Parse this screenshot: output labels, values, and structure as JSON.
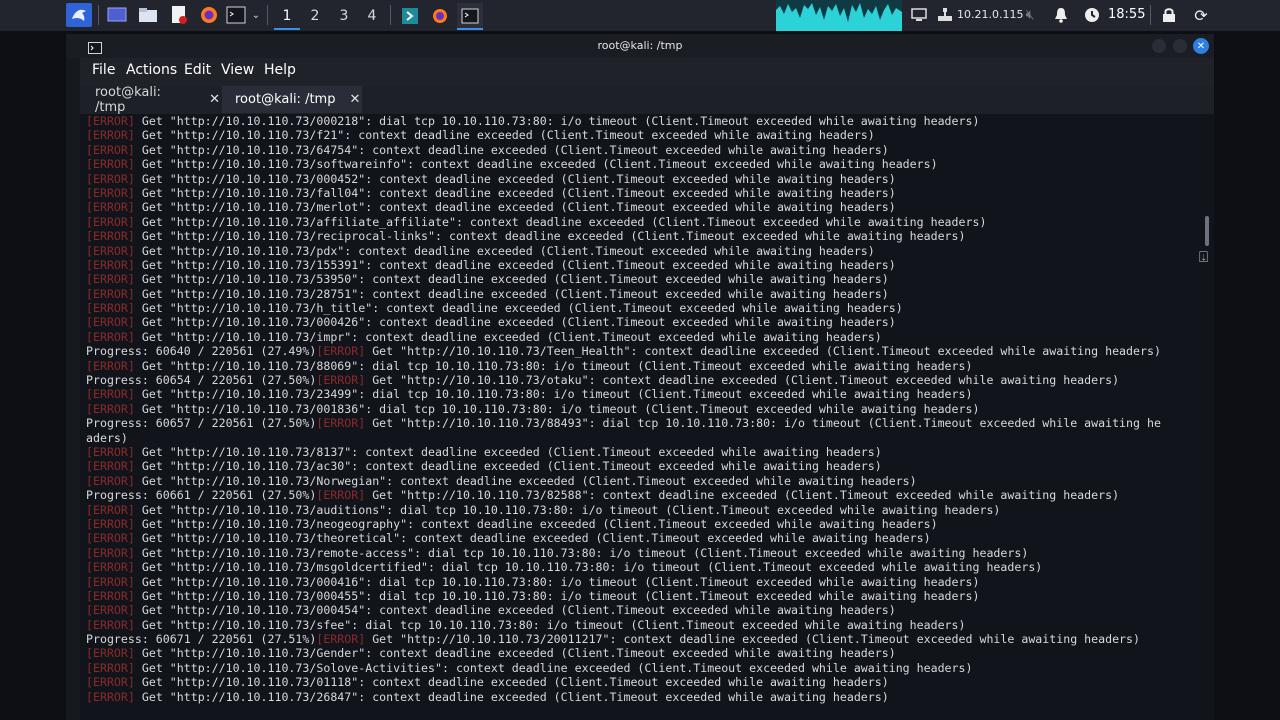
{
  "panel": {
    "workspaces": [
      "1",
      "2",
      "3",
      "4"
    ],
    "active_workspace": "1",
    "ip": "10.21.0.115",
    "clock": "18:55",
    "accent": "#3b8eea",
    "icons": [
      "kali-menu-icon",
      "desktop-icon",
      "file-manager-icon",
      "text-editor-icon",
      "firefox-icon",
      "terminal-icon",
      "chevron-down-icon",
      "power-shell-icon",
      "firefox-task-icon",
      "terminal-task-icon",
      "display-icon",
      "network-icon",
      "mute-icon",
      "notification-icon",
      "power-icon",
      "lock-icon",
      "refresh-icon"
    ]
  },
  "window": {
    "title": "root@kali: /tmp",
    "menu": [
      "File",
      "Actions",
      "Edit",
      "View",
      "Help"
    ],
    "tabs": [
      {
        "label": "root@kali: /tmp",
        "close": "✕",
        "active": false
      },
      {
        "label": "root@kali: /tmp",
        "close": "✕",
        "active": true
      }
    ]
  },
  "terminal": {
    "error_tag": "[ERROR]",
    "lines": [
      {
        "t": "err",
        "msg": " Get \"http://10.10.110.73/000218\": dial tcp 10.10.110.73:80: i/o timeout (Client.Timeout exceeded while awaiting headers)"
      },
      {
        "t": "err",
        "msg": " Get \"http://10.10.110.73/f21\": context deadline exceeded (Client.Timeout exceeded while awaiting headers)"
      },
      {
        "t": "err",
        "msg": " Get \"http://10.10.110.73/64754\": context deadline exceeded (Client.Timeout exceeded while awaiting headers)"
      },
      {
        "t": "err",
        "msg": " Get \"http://10.10.110.73/softwareinfo\": context deadline exceeded (Client.Timeout exceeded while awaiting headers)"
      },
      {
        "t": "err",
        "msg": " Get \"http://10.10.110.73/000452\": context deadline exceeded (Client.Timeout exceeded while awaiting headers)"
      },
      {
        "t": "err",
        "msg": " Get \"http://10.10.110.73/fall04\": context deadline exceeded (Client.Timeout exceeded while awaiting headers)"
      },
      {
        "t": "err",
        "msg": " Get \"http://10.10.110.73/merlot\": context deadline exceeded (Client.Timeout exceeded while awaiting headers)"
      },
      {
        "t": "err",
        "msg": " Get \"http://10.10.110.73/affiliate_affiliate\": context deadline exceeded (Client.Timeout exceeded while awaiting headers)"
      },
      {
        "t": "err",
        "msg": " Get \"http://10.10.110.73/reciprocal-links\": context deadline exceeded (Client.Timeout exceeded while awaiting headers)"
      },
      {
        "t": "err",
        "msg": " Get \"http://10.10.110.73/pdx\": context deadline exceeded (Client.Timeout exceeded while awaiting headers)"
      },
      {
        "t": "err",
        "msg": " Get \"http://10.10.110.73/155391\": context deadline exceeded (Client.Timeout exceeded while awaiting headers)"
      },
      {
        "t": "err",
        "msg": " Get \"http://10.10.110.73/53950\": context deadline exceeded (Client.Timeout exceeded while awaiting headers)"
      },
      {
        "t": "err",
        "msg": " Get \"http://10.10.110.73/28751\": context deadline exceeded (Client.Timeout exceeded while awaiting headers)"
      },
      {
        "t": "err",
        "msg": " Get \"http://10.10.110.73/h_title\": context deadline exceeded (Client.Timeout exceeded while awaiting headers)"
      },
      {
        "t": "err",
        "msg": " Get \"http://10.10.110.73/000426\": context deadline exceeded (Client.Timeout exceeded while awaiting headers)"
      },
      {
        "t": "err",
        "msg": " Get \"http://10.10.110.73/impr\": context deadline exceeded (Client.Timeout exceeded while awaiting headers)"
      },
      {
        "t": "prog",
        "pre": "Progress: 60640 / 220561 (27.49%)",
        "msg": " Get \"http://10.10.110.73/Teen_Health\": context deadline exceeded (Client.Timeout exceeded while awaiting headers)"
      },
      {
        "t": "err",
        "msg": " Get \"http://10.10.110.73/88069\": dial tcp 10.10.110.73:80: i/o timeout (Client.Timeout exceeded while awaiting headers)"
      },
      {
        "t": "prog",
        "pre": "Progress: 60654 / 220561 (27.50%)",
        "msg": " Get \"http://10.10.110.73/otaku\": context deadline exceeded (Client.Timeout exceeded while awaiting headers)"
      },
      {
        "t": "err",
        "msg": " Get \"http://10.10.110.73/23499\": dial tcp 10.10.110.73:80: i/o timeout (Client.Timeout exceeded while awaiting headers)"
      },
      {
        "t": "err",
        "msg": " Get \"http://10.10.110.73/001836\": dial tcp 10.10.110.73:80: i/o timeout (Client.Timeout exceeded while awaiting headers)"
      },
      {
        "t": "prog",
        "pre": "Progress: 60657 / 220561 (27.50%)",
        "msg": " Get \"http://10.10.110.73/88493\": dial tcp 10.10.110.73:80: i/o timeout (Client.Timeout exceeded while awaiting he"
      },
      {
        "t": "plain",
        "msg": "aders)"
      },
      {
        "t": "err",
        "msg": " Get \"http://10.10.110.73/8137\": context deadline exceeded (Client.Timeout exceeded while awaiting headers)"
      },
      {
        "t": "err",
        "msg": " Get \"http://10.10.110.73/ac30\": context deadline exceeded (Client.Timeout exceeded while awaiting headers)"
      },
      {
        "t": "err",
        "msg": " Get \"http://10.10.110.73/Norwegian\": context deadline exceeded (Client.Timeout exceeded while awaiting headers)"
      },
      {
        "t": "prog",
        "pre": "Progress: 60661 / 220561 (27.50%)",
        "msg": " Get \"http://10.10.110.73/82588\": context deadline exceeded (Client.Timeout exceeded while awaiting headers)"
      },
      {
        "t": "err",
        "msg": " Get \"http://10.10.110.73/auditions\": dial tcp 10.10.110.73:80: i/o timeout (Client.Timeout exceeded while awaiting headers)"
      },
      {
        "t": "err",
        "msg": " Get \"http://10.10.110.73/neogeography\": context deadline exceeded (Client.Timeout exceeded while awaiting headers)"
      },
      {
        "t": "err",
        "msg": " Get \"http://10.10.110.73/theoretical\": context deadline exceeded (Client.Timeout exceeded while awaiting headers)"
      },
      {
        "t": "err",
        "msg": " Get \"http://10.10.110.73/remote-access\": dial tcp 10.10.110.73:80: i/o timeout (Client.Timeout exceeded while awaiting headers)"
      },
      {
        "t": "err",
        "msg": " Get \"http://10.10.110.73/msgoldcertified\": dial tcp 10.10.110.73:80: i/o timeout (Client.Timeout exceeded while awaiting headers)"
      },
      {
        "t": "err",
        "msg": " Get \"http://10.10.110.73/000416\": dial tcp 10.10.110.73:80: i/o timeout (Client.Timeout exceeded while awaiting headers)"
      },
      {
        "t": "err",
        "msg": " Get \"http://10.10.110.73/000455\": dial tcp 10.10.110.73:80: i/o timeout (Client.Timeout exceeded while awaiting headers)"
      },
      {
        "t": "err",
        "msg": " Get \"http://10.10.110.73/000454\": context deadline exceeded (Client.Timeout exceeded while awaiting headers)"
      },
      {
        "t": "err",
        "msg": " Get \"http://10.10.110.73/sfee\": dial tcp 10.10.110.73:80: i/o timeout (Client.Timeout exceeded while awaiting headers)"
      },
      {
        "t": "prog",
        "pre": "Progress: 60671 / 220561 (27.51%)",
        "msg": " Get \"http://10.10.110.73/20011217\": context deadline exceeded (Client.Timeout exceeded while awaiting headers)"
      },
      {
        "t": "err",
        "msg": " Get \"http://10.10.110.73/Gender\": context deadline exceeded (Client.Timeout exceeded while awaiting headers)"
      },
      {
        "t": "err",
        "msg": " Get \"http://10.10.110.73/Solove-Activities\": context deadline exceeded (Client.Timeout exceeded while awaiting headers)"
      },
      {
        "t": "err",
        "msg": " Get \"http://10.10.110.73/01118\": context deadline exceeded (Client.Timeout exceeded while awaiting headers)"
      },
      {
        "t": "err",
        "msg": " Get \"http://10.10.110.73/26847\": context deadline exceeded (Client.Timeout exceeded while awaiting headers)"
      }
    ]
  }
}
